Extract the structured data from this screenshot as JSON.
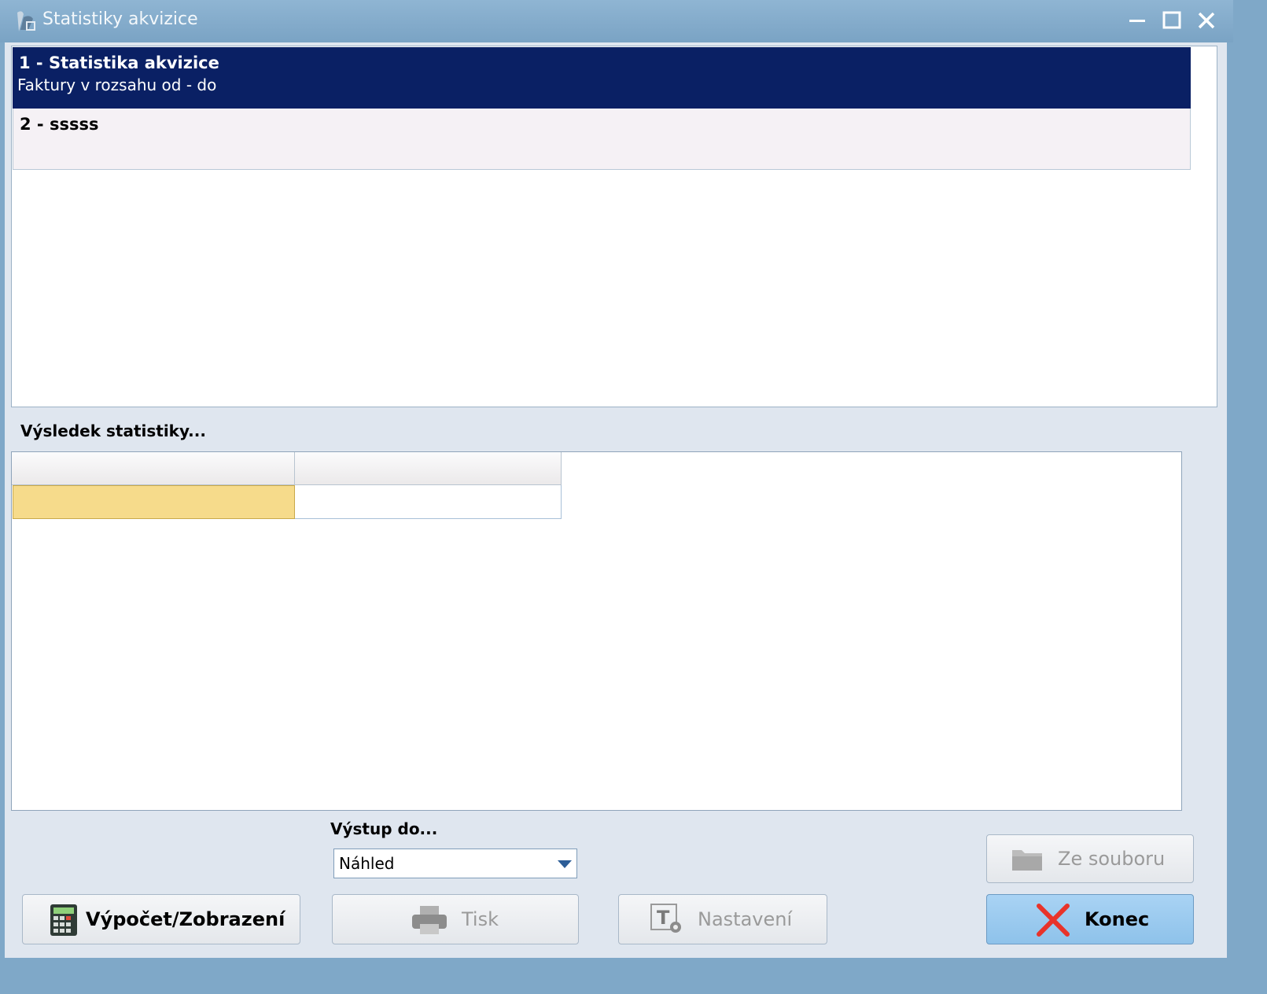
{
  "window": {
    "title": "Statistiky akvizice",
    "icons": {
      "app": "app-logo-icon",
      "minimize": "minimize-icon",
      "maximize": "maximize-icon",
      "close": "close-icon"
    }
  },
  "list": {
    "items": [
      {
        "title": "1 - Statistika akvizice",
        "subtitle": "Faktury v rozsahu od - do",
        "selected": true
      },
      {
        "title": "2 - sssss",
        "subtitle": "",
        "selected": false
      }
    ]
  },
  "result": {
    "label": "Výsledek statistiky..."
  },
  "output": {
    "label": "Výstup do...",
    "selected": "Náhled"
  },
  "buttons": {
    "calculate": "Výpočet/Zobrazení",
    "print": "Tisk",
    "settings": "Nastavení",
    "from_file": "Ze souboru",
    "close": "Konec"
  },
  "colors": {
    "selection": "#0a2064",
    "active_cell": "#f6db8b",
    "primary_button": "#8ec2ea",
    "close_x": "#e8332a"
  }
}
